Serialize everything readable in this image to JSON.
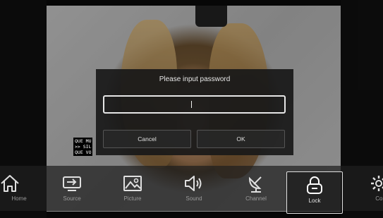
{
  "dialog": {
    "title": "Please input password",
    "password_value": "",
    "cancel_label": "Cancel",
    "ok_label": "OK"
  },
  "terminal": {
    "lines": [
      "QUE MU",
      ">> SIL",
      "QUE VO"
    ]
  },
  "menu": {
    "items": [
      {
        "label": "Home",
        "icon": "home-icon"
      },
      {
        "label": "Source",
        "icon": "source-icon"
      },
      {
        "label": "Picture",
        "icon": "picture-icon"
      },
      {
        "label": "Sound",
        "icon": "sound-icon"
      },
      {
        "label": "Channel",
        "icon": "channel-icon"
      },
      {
        "label": "Lock",
        "icon": "lock-icon",
        "selected": true
      },
      {
        "label": "Comm",
        "icon": "gear-icon"
      }
    ]
  },
  "colors": {
    "menu_bar": "#1e1e1e",
    "dialog_bg": "#191919",
    "field_border": "#e6e6e6",
    "label_inactive": "#9a9a9a",
    "label_active": "#e6e6e6"
  }
}
